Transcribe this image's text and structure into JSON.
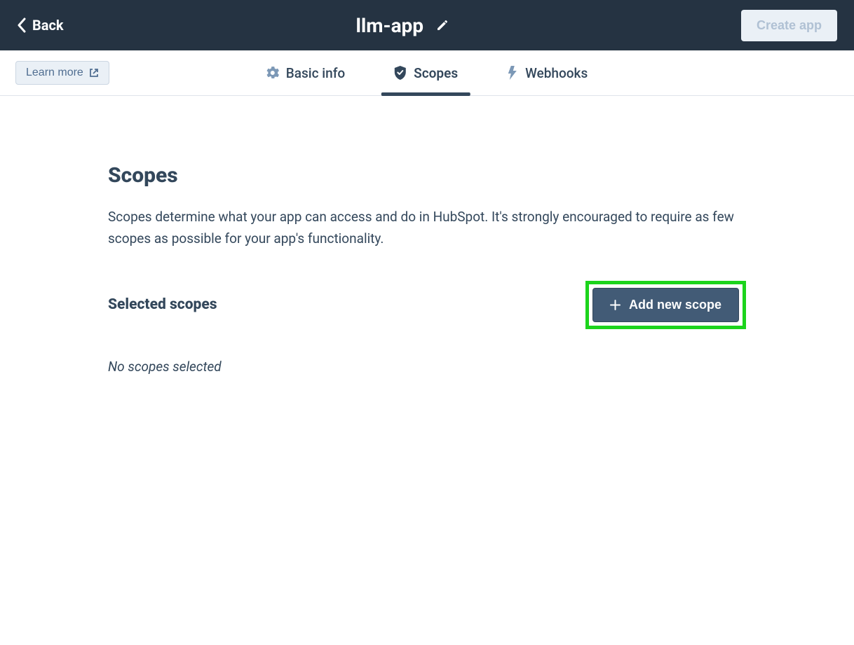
{
  "header": {
    "back_label": "Back",
    "app_title": "llm-app",
    "create_app_label": "Create app"
  },
  "tabbar": {
    "learn_more_label": "Learn more",
    "tabs": [
      {
        "label": "Basic info"
      },
      {
        "label": "Scopes"
      },
      {
        "label": "Webhooks"
      }
    ]
  },
  "main": {
    "heading": "Scopes",
    "description": "Scopes determine what your app can access and do in HubSpot. It's strongly encouraged to require as few scopes as possible for your app's functionality.",
    "selected_heading": "Selected scopes",
    "add_scope_label": "Add new scope",
    "empty_message": "No scopes selected"
  }
}
